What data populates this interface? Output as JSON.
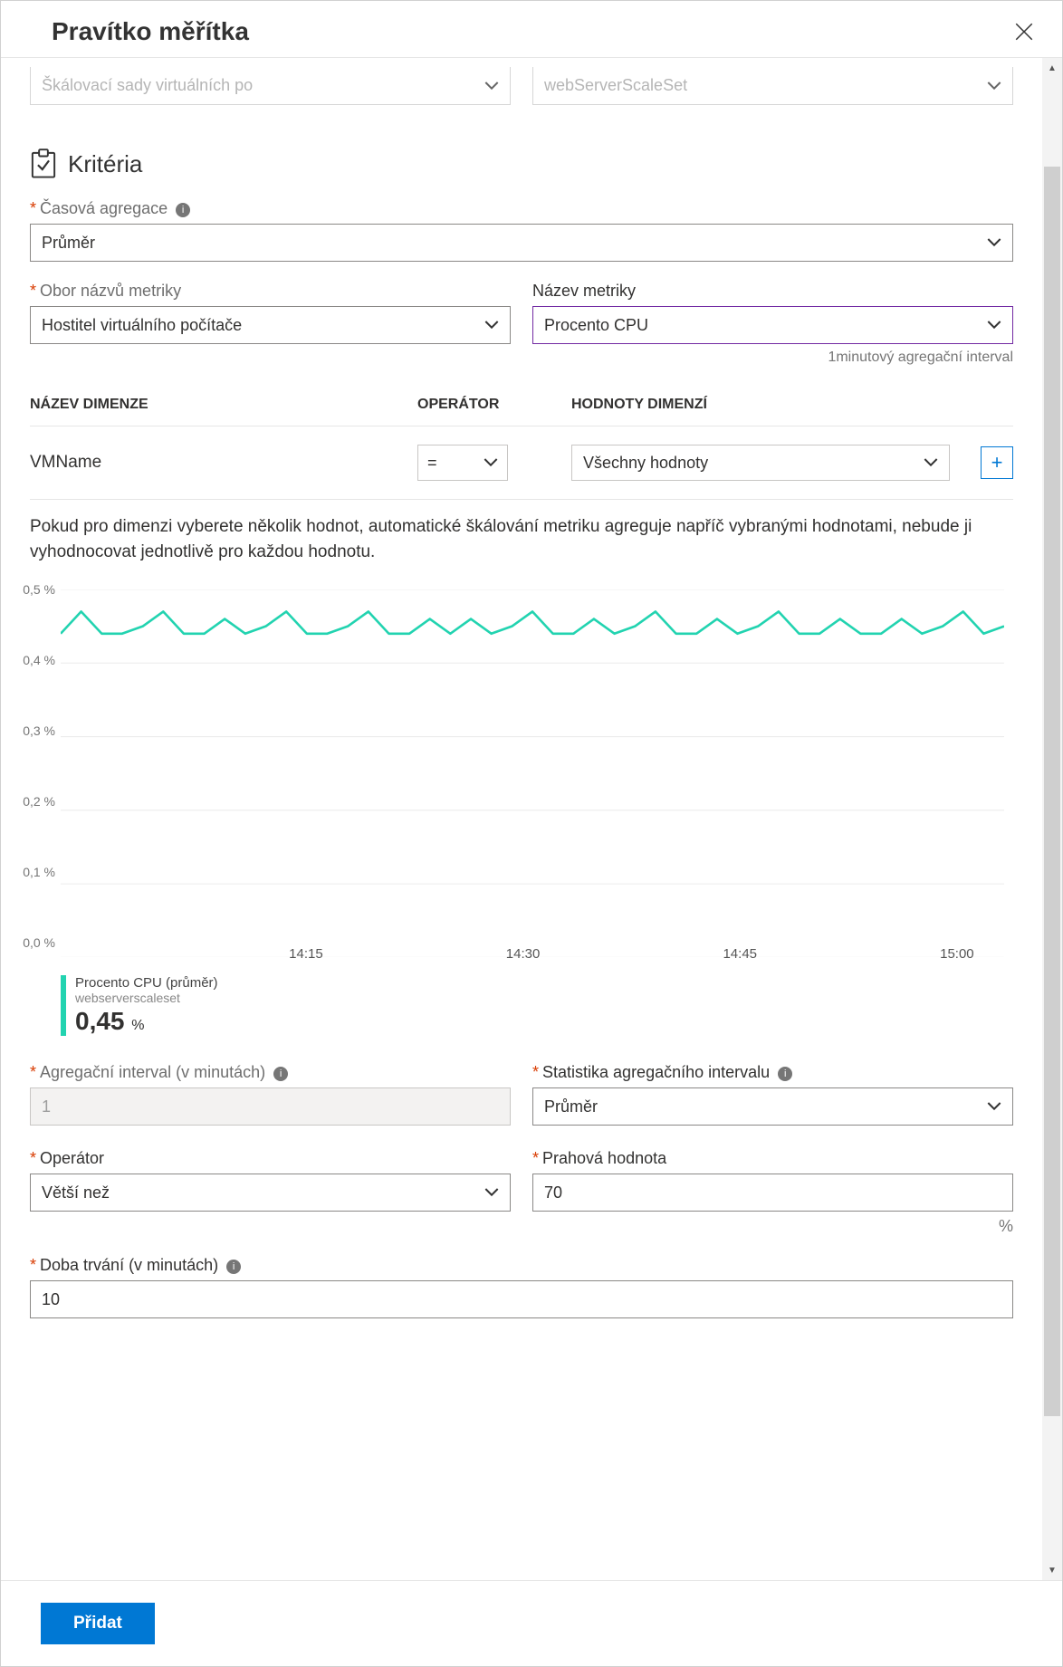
{
  "header": {
    "title": "Pravítko měřítka"
  },
  "top_selects": {
    "left_placeholder": "Škálovací sady virtuálních po",
    "right_placeholder": "webServerScaleSet"
  },
  "criteria": {
    "section_title": "Kritéria",
    "time_agg_label": "Časová agregace",
    "time_agg_value": "Průměr",
    "namespace_label": "Obor názvů metriky",
    "namespace_value": "Hostitel virtuálního počítače",
    "metric_label": "Název metriky",
    "metric_value": "Procento CPU",
    "interval_hint": "1minutový agregační interval"
  },
  "dimensions": {
    "headers": {
      "name": "NÁZEV DIMENZE",
      "operator": "OPERÁTOR",
      "values": "HODNOTY DIMENZÍ"
    },
    "row": {
      "name": "VMName",
      "operator": "=",
      "value": "Všechny hodnoty"
    },
    "note": "Pokud pro dimenzi vyberete několik hodnot, automatické škálování metriku agreguje napříč vybranými hodnotami, nebude ji vyhodnocovat jednotlivě pro každou hodnotu."
  },
  "legend": {
    "line1": "Procento CPU (průměr)",
    "line2": "webserverscaleset",
    "value": "0,45",
    "unit": "%"
  },
  "form": {
    "agg_interval_label": "Agregační interval (v minutách)",
    "agg_interval_value": "1",
    "stat_label": "Statistika agregačního intervalu",
    "stat_value": "Průměr",
    "operator_label": "Operátor",
    "operator_value": "Větší než",
    "threshold_label": "Prahová hodnota",
    "threshold_value": "70",
    "threshold_unit": "%",
    "duration_label": "Doba trvání (v minutách)",
    "duration_value": "10"
  },
  "footer": {
    "add_label": "Přidat"
  },
  "chart_data": {
    "type": "line",
    "title": "",
    "xlabel": "",
    "ylabel": "",
    "ylim": [
      0.0,
      0.5
    ],
    "y_ticks": [
      "0,0 %",
      "0,1 %",
      "0,2 %",
      "0,3 %",
      "0,4 %",
      "0,5 %"
    ],
    "x_ticks": [
      "14:15",
      "14:30",
      "14:45",
      "15:00"
    ],
    "series": [
      {
        "name": "Procento CPU (průměr)",
        "color": "#22d3b0",
        "values": [
          0.44,
          0.47,
          0.44,
          0.44,
          0.45,
          0.47,
          0.44,
          0.44,
          0.46,
          0.44,
          0.45,
          0.47,
          0.44,
          0.44,
          0.45,
          0.47,
          0.44,
          0.44,
          0.46,
          0.44,
          0.46,
          0.44,
          0.45,
          0.47,
          0.44,
          0.44,
          0.46,
          0.44,
          0.45,
          0.47,
          0.44,
          0.44,
          0.46,
          0.44,
          0.45,
          0.47,
          0.44,
          0.44,
          0.46,
          0.44,
          0.44,
          0.46,
          0.44,
          0.45,
          0.47,
          0.44,
          0.45
        ]
      }
    ]
  }
}
